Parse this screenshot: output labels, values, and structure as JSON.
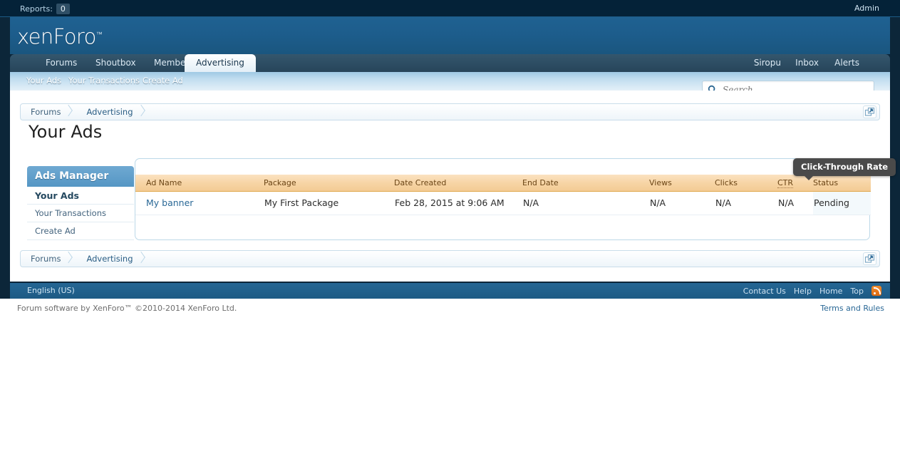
{
  "topbar": {
    "reports_label": "Reports:",
    "reports_count": "0",
    "admin_label": "Admin"
  },
  "header": {
    "logo_text": "xenForo",
    "logo_tm": "™"
  },
  "nav": {
    "tabs": [
      {
        "label": "Forums",
        "selected": false
      },
      {
        "label": "Shoutbox",
        "selected": false
      },
      {
        "label": "Members",
        "selected": false
      },
      {
        "label": "Advertising",
        "selected": true
      }
    ],
    "right_items": [
      {
        "label": "Siropu"
      },
      {
        "label": "Inbox"
      },
      {
        "label": "Alerts"
      }
    ]
  },
  "subnav": {
    "items": [
      {
        "label": "Your Ads"
      },
      {
        "label": "Your Transactions"
      },
      {
        "label": "Create Ad"
      }
    ]
  },
  "search": {
    "value": "",
    "placeholder": "Search...",
    "icon": "search-icon"
  },
  "breadcrumb_top": {
    "crumbs": [
      {
        "label": "Forums"
      },
      {
        "label": "Advertising"
      }
    ],
    "share_icon": "open-in-new-window-icon"
  },
  "breadcrumb_bottom": {
    "crumbs": [
      {
        "label": "Forums"
      },
      {
        "label": "Advertising"
      }
    ],
    "share_icon": "open-in-new-window-icon"
  },
  "page": {
    "title": "Your Ads"
  },
  "sidebar": {
    "heading": "Ads Manager",
    "items": [
      {
        "label": "Your Ads",
        "active": true
      },
      {
        "label": "Your Transactions",
        "active": false
      },
      {
        "label": "Create Ad",
        "active": false
      }
    ]
  },
  "table": {
    "columns": [
      {
        "label": "Ad Name",
        "abbr": false
      },
      {
        "label": "Package",
        "abbr": false
      },
      {
        "label": "Date Created",
        "abbr": false
      },
      {
        "label": "End Date",
        "abbr": false
      },
      {
        "label": "Views",
        "abbr": false
      },
      {
        "label": "Clicks",
        "abbr": false
      },
      {
        "label": "CTR",
        "abbr": true
      },
      {
        "label": "Status",
        "abbr": false
      }
    ],
    "rows": [
      {
        "ad_name": "My banner",
        "package": "My First Package",
        "date_created": "Feb 28, 2015 at 9:06 AM",
        "end_date": "N/A",
        "views": "N/A",
        "clicks": "N/A",
        "ctr": "N/A",
        "status": "Pending"
      }
    ]
  },
  "tooltip": {
    "text": "Click-Through Rate"
  },
  "footer": {
    "language": "English (US)",
    "links": [
      {
        "label": "Contact Us"
      },
      {
        "label": "Help"
      },
      {
        "label": "Home"
      },
      {
        "label": "Top"
      }
    ],
    "rss_icon": "rss-feed-icon",
    "copyright": "Forum software by XenForo™ ©2010-2014 XenForo Ltd.",
    "terms": "Terms and Rules"
  },
  "colors": {
    "brand_blue": "#1d5d8c",
    "dark_navy": "#0c2639",
    "table_header_orange": "#f7d5a6",
    "status_pending": "#f0ab4e",
    "link_blue": "#2a6896",
    "sidebar_head": "#5596c4"
  }
}
